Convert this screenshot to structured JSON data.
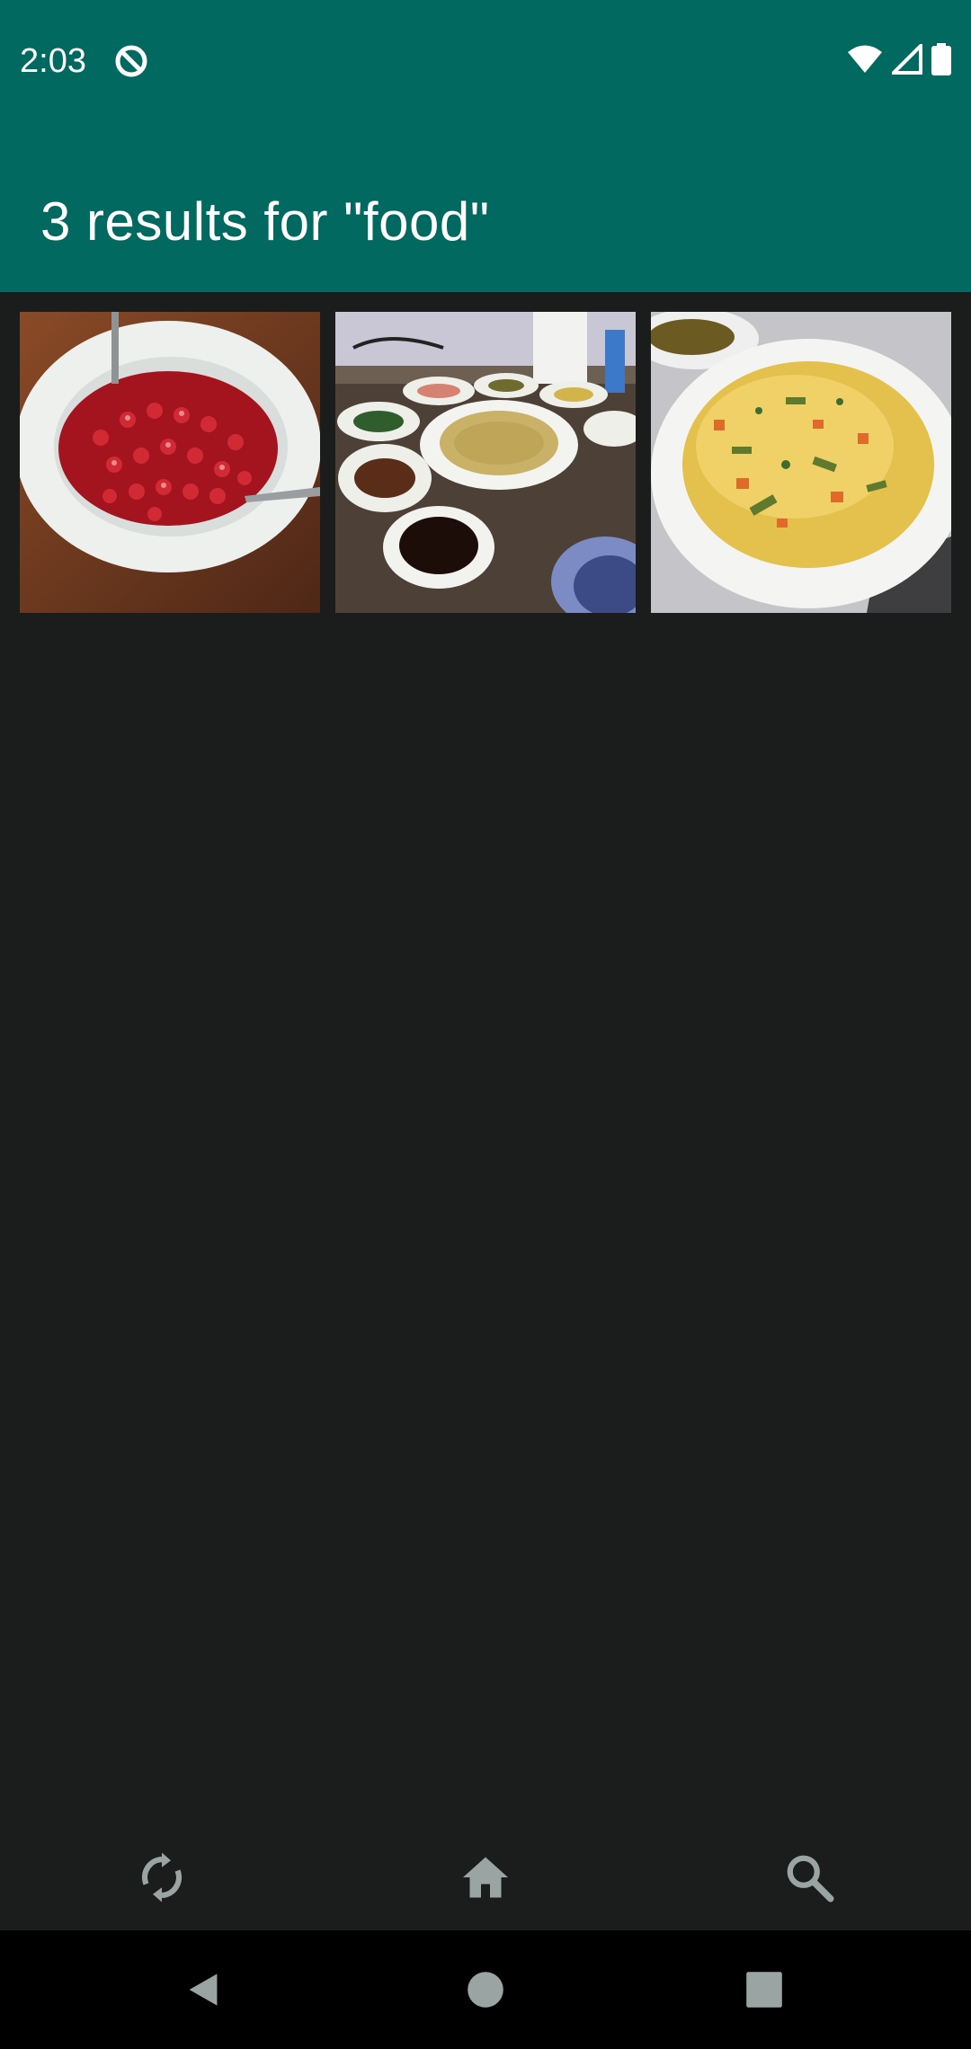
{
  "status_bar": {
    "time": "2:03",
    "icons": [
      "do-not-disturb-icon",
      "wifi-icon",
      "cellular-signal-icon",
      "battery-icon"
    ]
  },
  "header": {
    "title": "3 results for \"food\""
  },
  "results": [
    {
      "icon": "photo-thumbnail",
      "subject": "pomegranate-seeds-bowl"
    },
    {
      "icon": "photo-thumbnail",
      "subject": "korean-side-dishes-pancake"
    },
    {
      "icon": "photo-thumbnail",
      "subject": "vegetable-rice-plate"
    }
  ],
  "bottom_nav": {
    "items": [
      {
        "icon": "sync-icon"
      },
      {
        "icon": "home-icon"
      },
      {
        "icon": "search-icon"
      }
    ]
  },
  "system_nav": {
    "items": [
      {
        "icon": "back-icon"
      },
      {
        "icon": "home-circle-icon"
      },
      {
        "icon": "recents-icon"
      }
    ]
  },
  "colors": {
    "app_bar": "#026961",
    "background": "#1b1c1c",
    "system_nav": "#000000",
    "icon_gray": "#9aa4a3"
  }
}
